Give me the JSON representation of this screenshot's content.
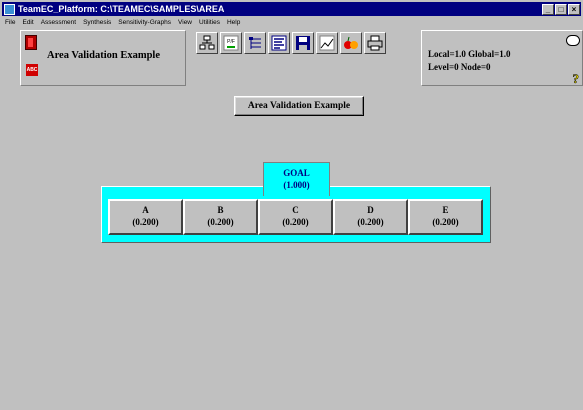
{
  "window": {
    "title": "TeamEC_Platform: C:\\TEAMEC\\SAMPLES\\AREA"
  },
  "menu": [
    "File",
    "Edit",
    "Assessment",
    "Synthesis",
    "Sensitivity-Graphs",
    "View",
    "Utilities",
    "Help"
  ],
  "header": {
    "panel_title": "Area Validation Example",
    "abc_icon_text": "ABC",
    "toolbar_pf_text": "P/F"
  },
  "status": {
    "line1": "Local=1.0 Global=1.0",
    "line2": "Level=0  Node=0",
    "help_glyph": "?"
  },
  "model_title": "Area Validation Example",
  "hierarchy": {
    "goal": {
      "label": "GOAL",
      "value": "(1.000)"
    },
    "children": [
      {
        "label": "A",
        "value": "(0.200)"
      },
      {
        "label": "B",
        "value": "(0.200)"
      },
      {
        "label": "C",
        "value": "(0.200)"
      },
      {
        "label": "D",
        "value": "(0.200)"
      },
      {
        "label": "E",
        "value": "(0.200)"
      }
    ]
  },
  "colors": {
    "title_bar": "#000080",
    "node_highlight": "#00ffff",
    "node_text": "#000080"
  }
}
